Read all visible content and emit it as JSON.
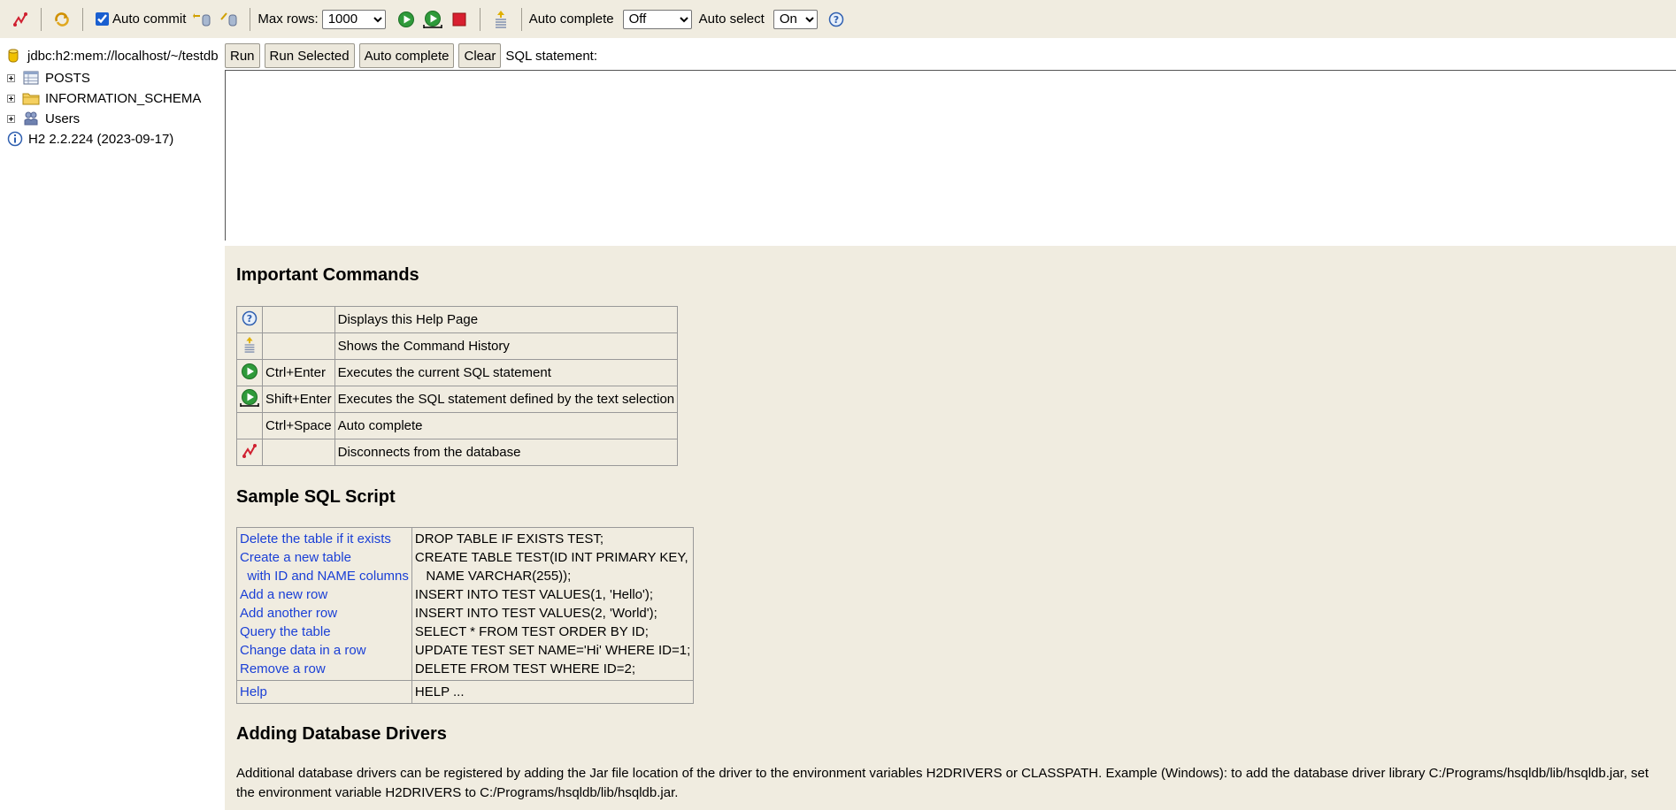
{
  "toolbar": {
    "auto_commit_label": "Auto commit",
    "auto_commit_checked": true,
    "max_rows_label": "Max rows:",
    "max_rows_value": "1000",
    "auto_complete_label": "Auto complete",
    "auto_complete_value": "Off",
    "auto_select_label": "Auto select",
    "auto_select_value": "On"
  },
  "tree": {
    "connection": "jdbc:h2:mem://localhost/~/testdb",
    "items": [
      {
        "label": "POSTS",
        "icon": "table-icon"
      },
      {
        "label": "INFORMATION_SCHEMA",
        "icon": "folder-icon"
      },
      {
        "label": "Users",
        "icon": "users-icon"
      }
    ],
    "version": "H2 2.2.224 (2023-09-17)"
  },
  "sql": {
    "run": "Run",
    "run_selected": "Run Selected",
    "auto_complete": "Auto complete",
    "clear": "Clear",
    "statement_label": "SQL statement:"
  },
  "help": {
    "important_title": "Important Commands",
    "commands": [
      {
        "icon": "help-icon",
        "key": "",
        "desc": "Displays this Help Page"
      },
      {
        "icon": "history-icon",
        "key": "",
        "desc": "Shows the Command History"
      },
      {
        "icon": "run-icon",
        "key": "Ctrl+Enter",
        "desc": "Executes the current SQL statement"
      },
      {
        "icon": "run-selected-icon",
        "key": "Shift+Enter",
        "desc": "Executes the SQL statement defined by the text selection"
      },
      {
        "icon": "",
        "key": "Ctrl+Space",
        "desc": "Auto complete"
      },
      {
        "icon": "disconnect-icon",
        "key": "",
        "desc": "Disconnects from the database"
      }
    ],
    "sample_title": "Sample SQL Script",
    "sample_links": [
      "Delete the table if it exists",
      "Create a new table",
      "  with ID and NAME columns",
      "Add a new row",
      "Add another row",
      "Query the table",
      "Change data in a row",
      "Remove a row"
    ],
    "sample_code": [
      "DROP TABLE IF EXISTS TEST;",
      "CREATE TABLE TEST(ID INT PRIMARY KEY,",
      "   NAME VARCHAR(255));",
      "INSERT INTO TEST VALUES(1, 'Hello');",
      "INSERT INTO TEST VALUES(2, 'World');",
      "SELECT * FROM TEST ORDER BY ID;",
      "UPDATE TEST SET NAME='Hi' WHERE ID=1;",
      "DELETE FROM TEST WHERE ID=2;"
    ],
    "help_link": "Help",
    "help_code": "HELP ...",
    "drivers_title": "Adding Database Drivers",
    "drivers_text": "Additional database drivers can be registered by adding the Jar file location of the driver to the environment variables H2DRIVERS or CLASSPATH. Example (Windows): to add the database driver library C:/Programs/hsqldb/lib/hsqldb.jar, set the environment variable H2DRIVERS to C:/Programs/hsqldb/lib/hsqldb.jar."
  },
  "colors": {
    "toolbar_bg": "#f0ece0",
    "link": "#1a3fd6"
  }
}
